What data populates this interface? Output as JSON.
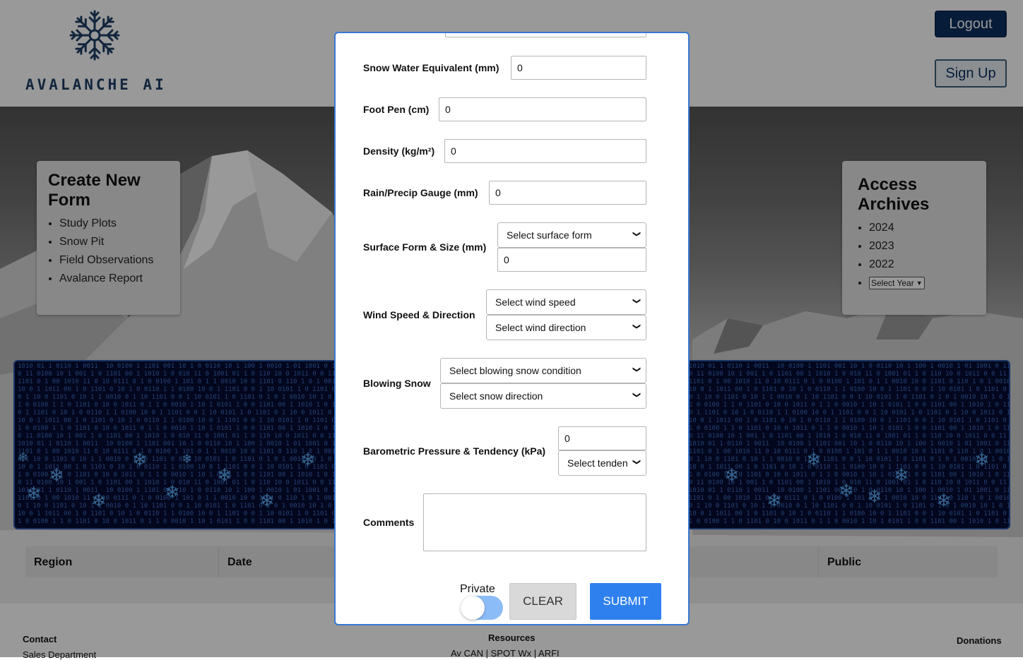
{
  "header": {
    "logo_text": "AVALANCHE AI",
    "logout_label": "Logout",
    "signup_label": "Sign Up"
  },
  "create_card": {
    "title": "Create New Form",
    "items": [
      "Study Plots",
      "Snow Pit",
      "Field Observations",
      "Avalance Report"
    ]
  },
  "archive_card": {
    "title": "Access Archives",
    "years": [
      "2024",
      "2023",
      "2022"
    ],
    "year_select": "Select Year"
  },
  "table": {
    "headers": [
      "Region",
      "Date",
      "Public"
    ]
  },
  "footer": {
    "contact_title": "Contact",
    "contact_line": "Sales Department",
    "resources_title": "Resources",
    "resources_links": "Av CAN | SPOT Wx | ARFI",
    "donations_title": "Donations"
  },
  "modal": {
    "swe": {
      "label": "Snow Water Equivalent (mm)",
      "value": "0"
    },
    "foot_pen": {
      "label": "Foot Pen (cm)",
      "value": "0"
    },
    "density": {
      "label": "Density (kg/m²)",
      "value": "0"
    },
    "rain": {
      "label": "Rain/Precip Gauge (mm)",
      "value": "0"
    },
    "surface": {
      "label": "Surface Form & Size (mm)",
      "select": "Select surface form",
      "value": "0"
    },
    "wind": {
      "label": "Wind Speed & Direction",
      "speed_select": "Select wind speed",
      "direction_select": "Select wind direction"
    },
    "blowing": {
      "label": "Blowing Snow",
      "condition_select": "Select blowing snow condition",
      "direction_select": "Select snow direction"
    },
    "baro": {
      "label": "Barometric Pressure & Tendency (kPa)",
      "value": "0",
      "tendency_select": "Select tenden"
    },
    "comments": {
      "label": "Comments",
      "value": ""
    },
    "private_label": "Private",
    "private_on": false,
    "clear_label": "CLEAR",
    "submit_label": "SUBMIT"
  },
  "colors": {
    "brand_navy": "#0d2f5e",
    "submit_blue": "#2f80ef",
    "modal_border": "#3877d2",
    "toggle_track": "#8cbcf7"
  }
}
